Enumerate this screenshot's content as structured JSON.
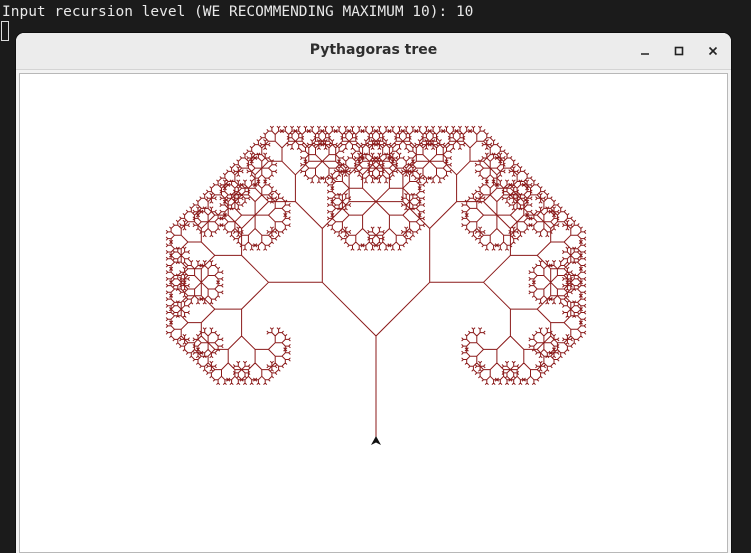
{
  "terminal": {
    "prompt": "Input recursion level (WE RECOMMENDING MAXIMUM 10): 10"
  },
  "window": {
    "title": "Pythagoras tree",
    "controls": [
      "minimize-icon",
      "maximize-icon",
      "close-icon"
    ]
  },
  "drawing": {
    "recursion_level": 10,
    "line_color": "#8b1a1a",
    "background": "#ffffff"
  }
}
